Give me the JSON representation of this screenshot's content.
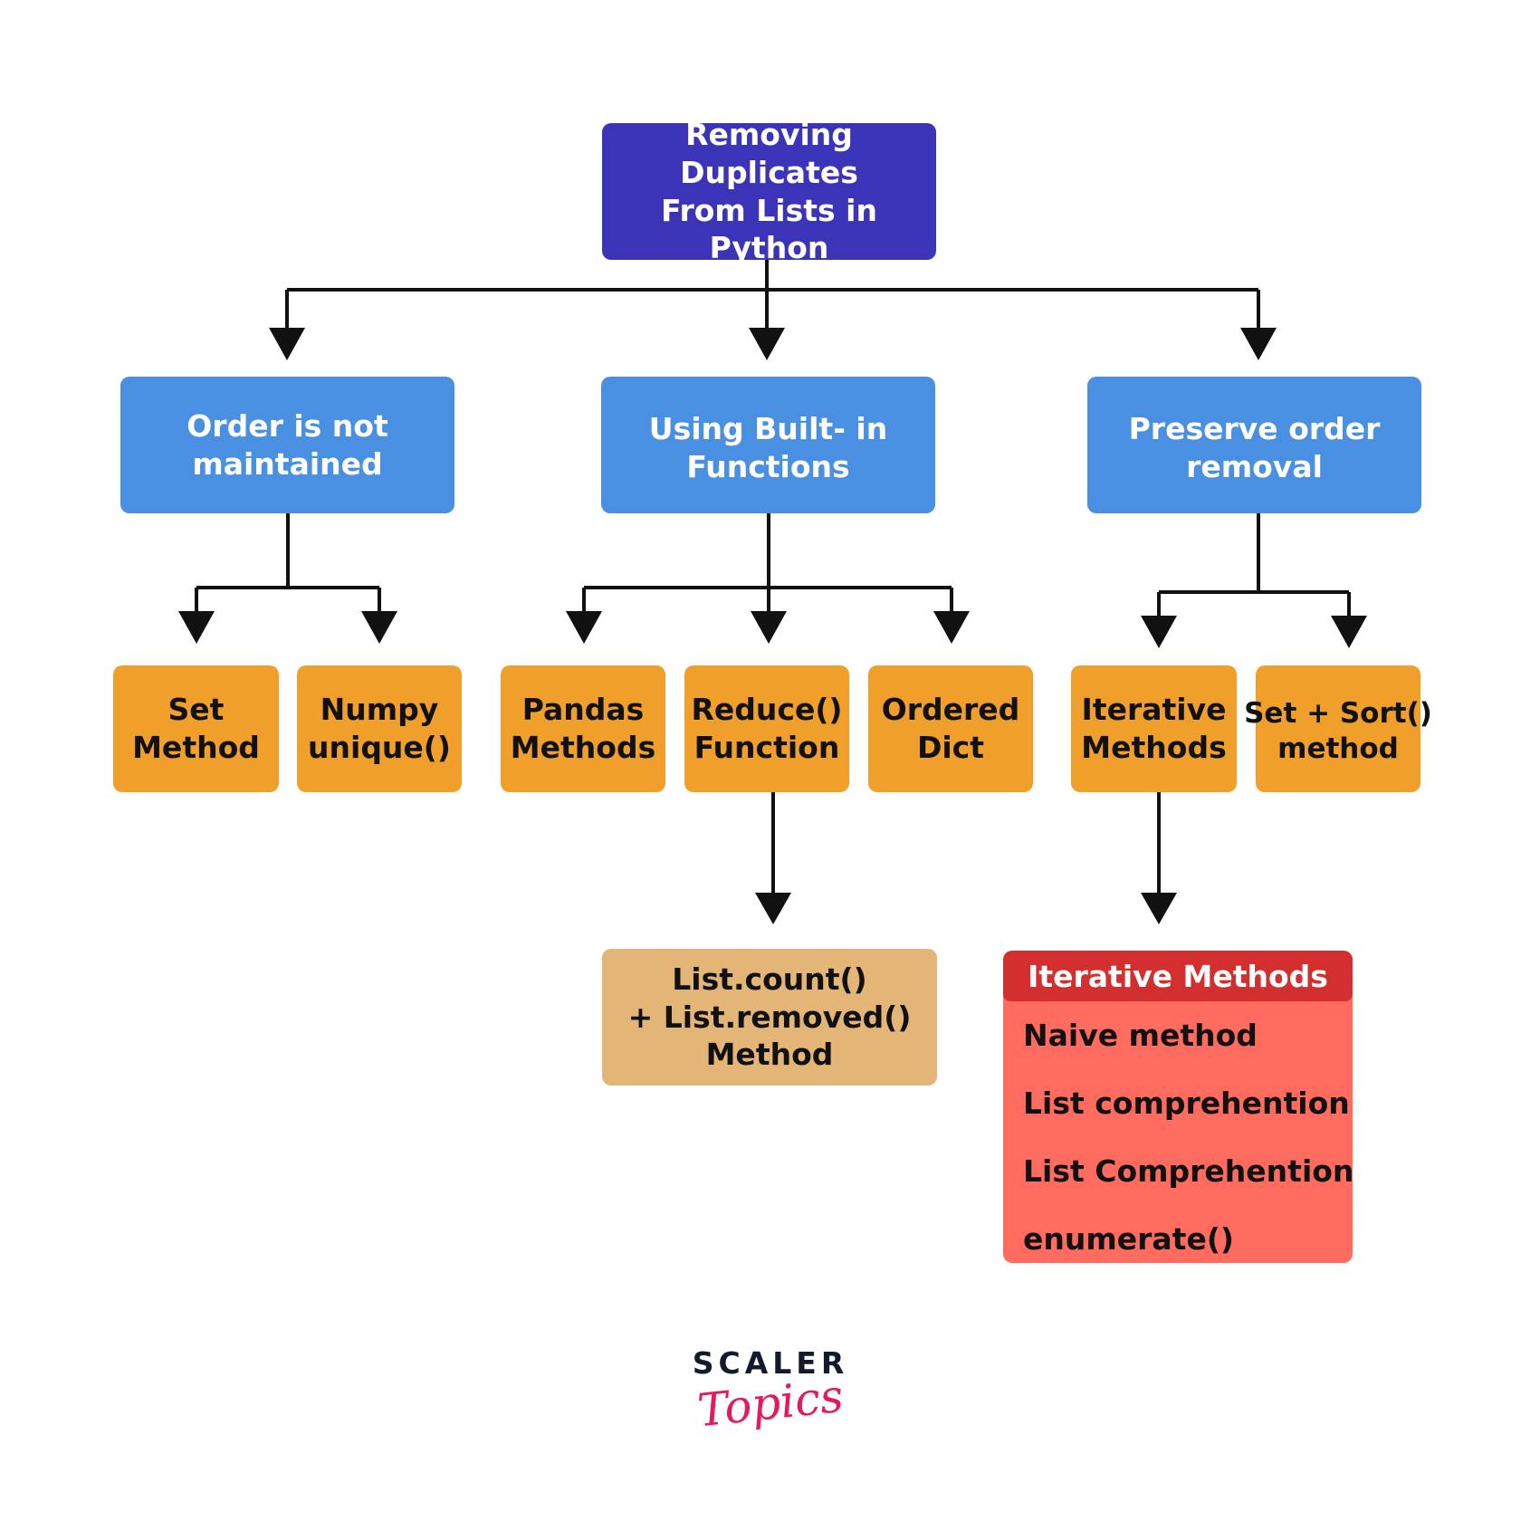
{
  "diagram": {
    "title_lines": [
      "Removing Duplicates",
      "From Lists in Python"
    ],
    "categories": [
      {
        "lines": [
          "Order is not",
          "maintained"
        ],
        "children": [
          {
            "lines": [
              "Set",
              "Method"
            ]
          },
          {
            "lines": [
              "Numpy",
              "unique()"
            ]
          }
        ]
      },
      {
        "lines": [
          "Using Built- in",
          "Functions"
        ],
        "children": [
          {
            "lines": [
              "Pandas",
              "Methods"
            ]
          },
          {
            "lines": [
              "Reduce()",
              "Function"
            ]
          },
          {
            "lines": [
              "Ordered",
              "Dict"
            ]
          }
        ]
      },
      {
        "lines": [
          "Preserve order",
          "removal"
        ],
        "children": [
          {
            "lines": [
              "Iterative",
              "Methods"
            ]
          },
          {
            "lines": [
              "Set + Sort()",
              "method"
            ]
          }
        ]
      }
    ],
    "reduce_detail": {
      "lines": [
        "List.count()",
        "+ List.removed()",
        "Method"
      ]
    },
    "iterative_detail": {
      "header": "Iterative Methods",
      "items": [
        "Naive method",
        "List comprehention",
        "List Comprehention +",
        "enumerate()"
      ]
    }
  },
  "logo": {
    "brand": "SCALER",
    "sub": "Topics"
  },
  "colors": {
    "root": "#3b33b8",
    "category": "#4a90e2",
    "leaf": "#ef9f2a",
    "reduce_detail": "#e3b577",
    "iterative_header": "#d32f2f",
    "iterative_body": "#ff6b5e",
    "connector": "#111111",
    "logo_brand": "#141a2e",
    "logo_sub": "#e5195e"
  }
}
